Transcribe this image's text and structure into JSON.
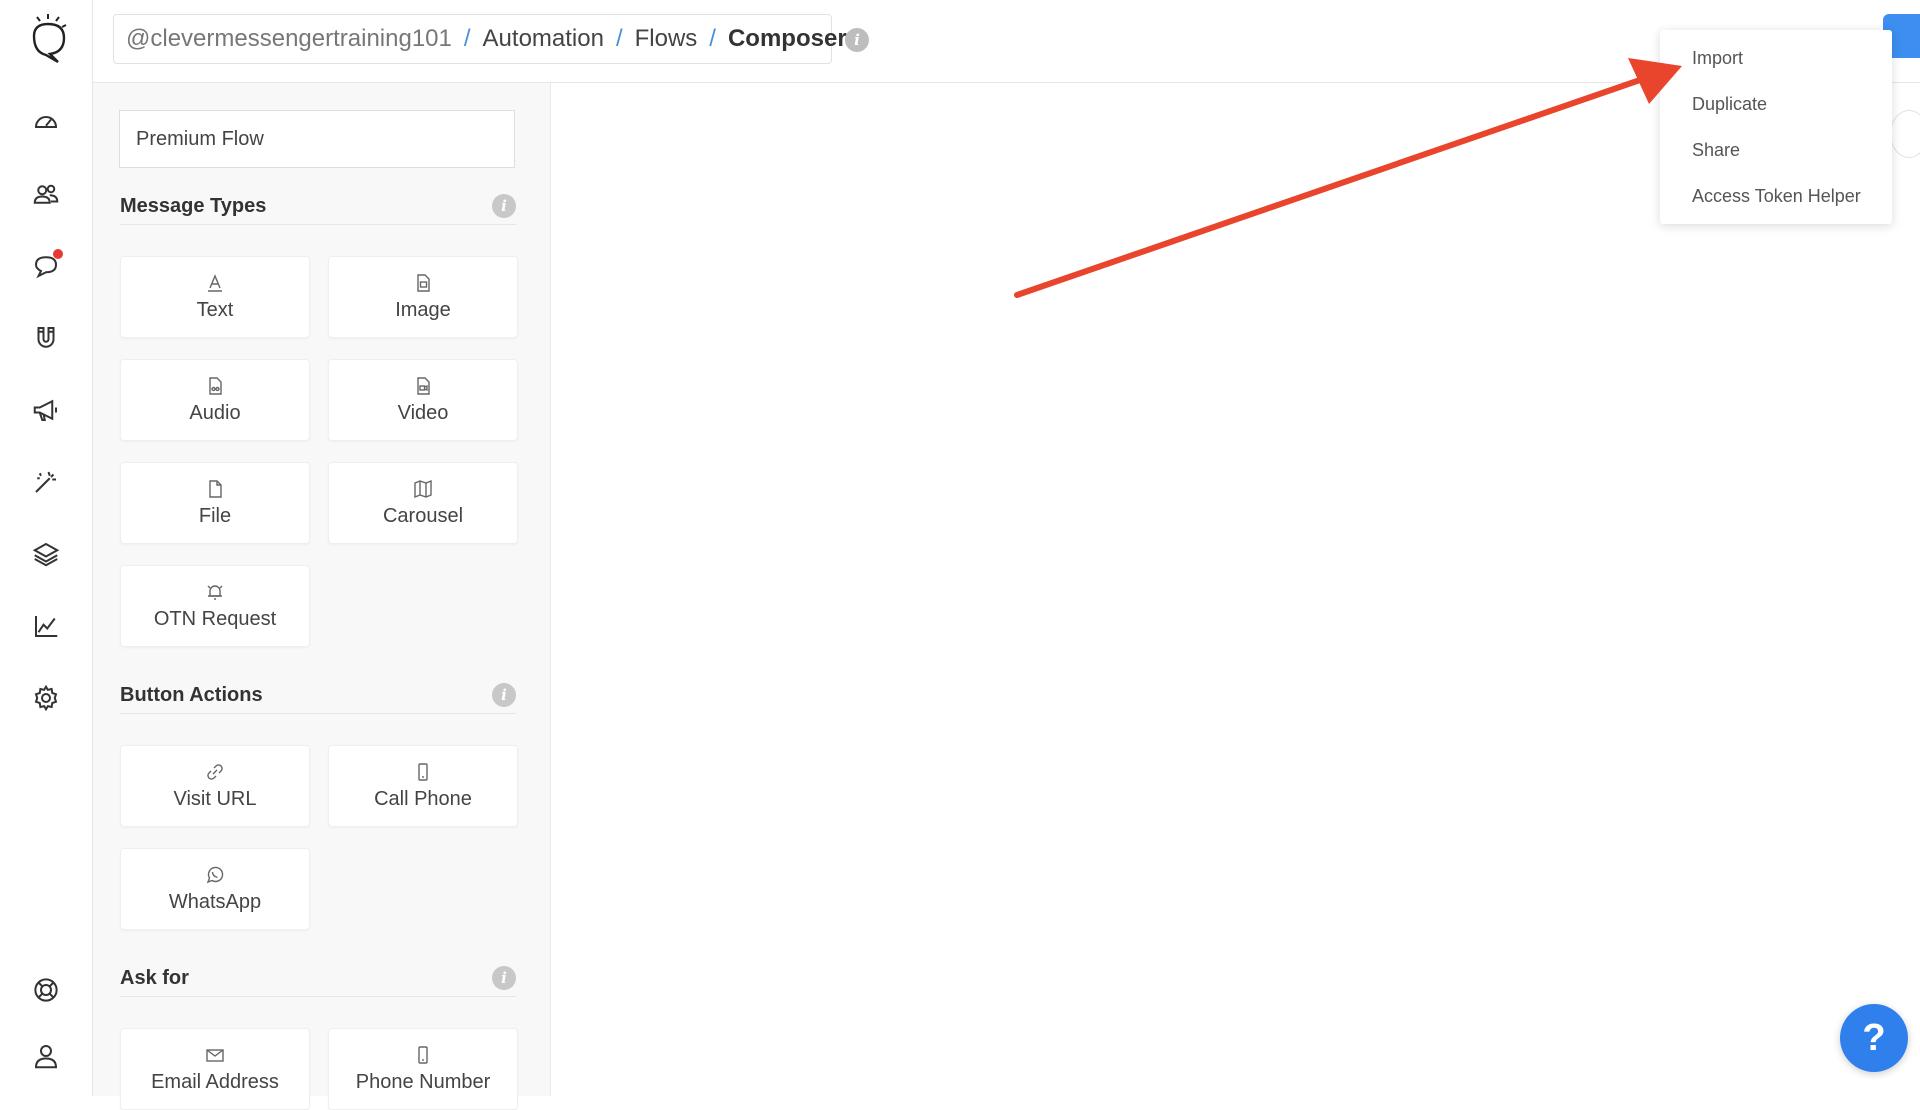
{
  "breadcrumb": {
    "account": "@clevermessengertraining101",
    "automation": "Automation",
    "flows": "Flows",
    "current": "Composer",
    "separator": "/"
  },
  "info_glyph": "i",
  "flow_name": "Premium Flow",
  "sections": {
    "message_types": "Message Types",
    "button_actions": "Button Actions",
    "ask_for": "Ask for"
  },
  "tiles": {
    "text": "Text",
    "image": "Image",
    "audio": "Audio",
    "video": "Video",
    "file": "File",
    "carousel": "Carousel",
    "otn_request": "OTN Request",
    "visit_url": "Visit URL",
    "call_phone": "Call Phone",
    "whatsapp": "WhatsApp",
    "email_address": "Email Address",
    "phone_number": "Phone Number"
  },
  "menu": {
    "items": [
      "Import",
      "Duplicate",
      "Share",
      "Access Token Helper"
    ]
  },
  "help_label": "?",
  "rail_icons": [
    "dashboard-icon",
    "users-icon",
    "chat-icon",
    "magnet-icon",
    "megaphone-icon",
    "magic-wand-icon",
    "layers-icon",
    "analytics-icon",
    "settings-icon",
    "lifebuoy-icon",
    "profile-icon"
  ],
  "colors": {
    "accent": "#3d8ef0",
    "arrow": "#e8452c",
    "notification": "#e53935"
  }
}
